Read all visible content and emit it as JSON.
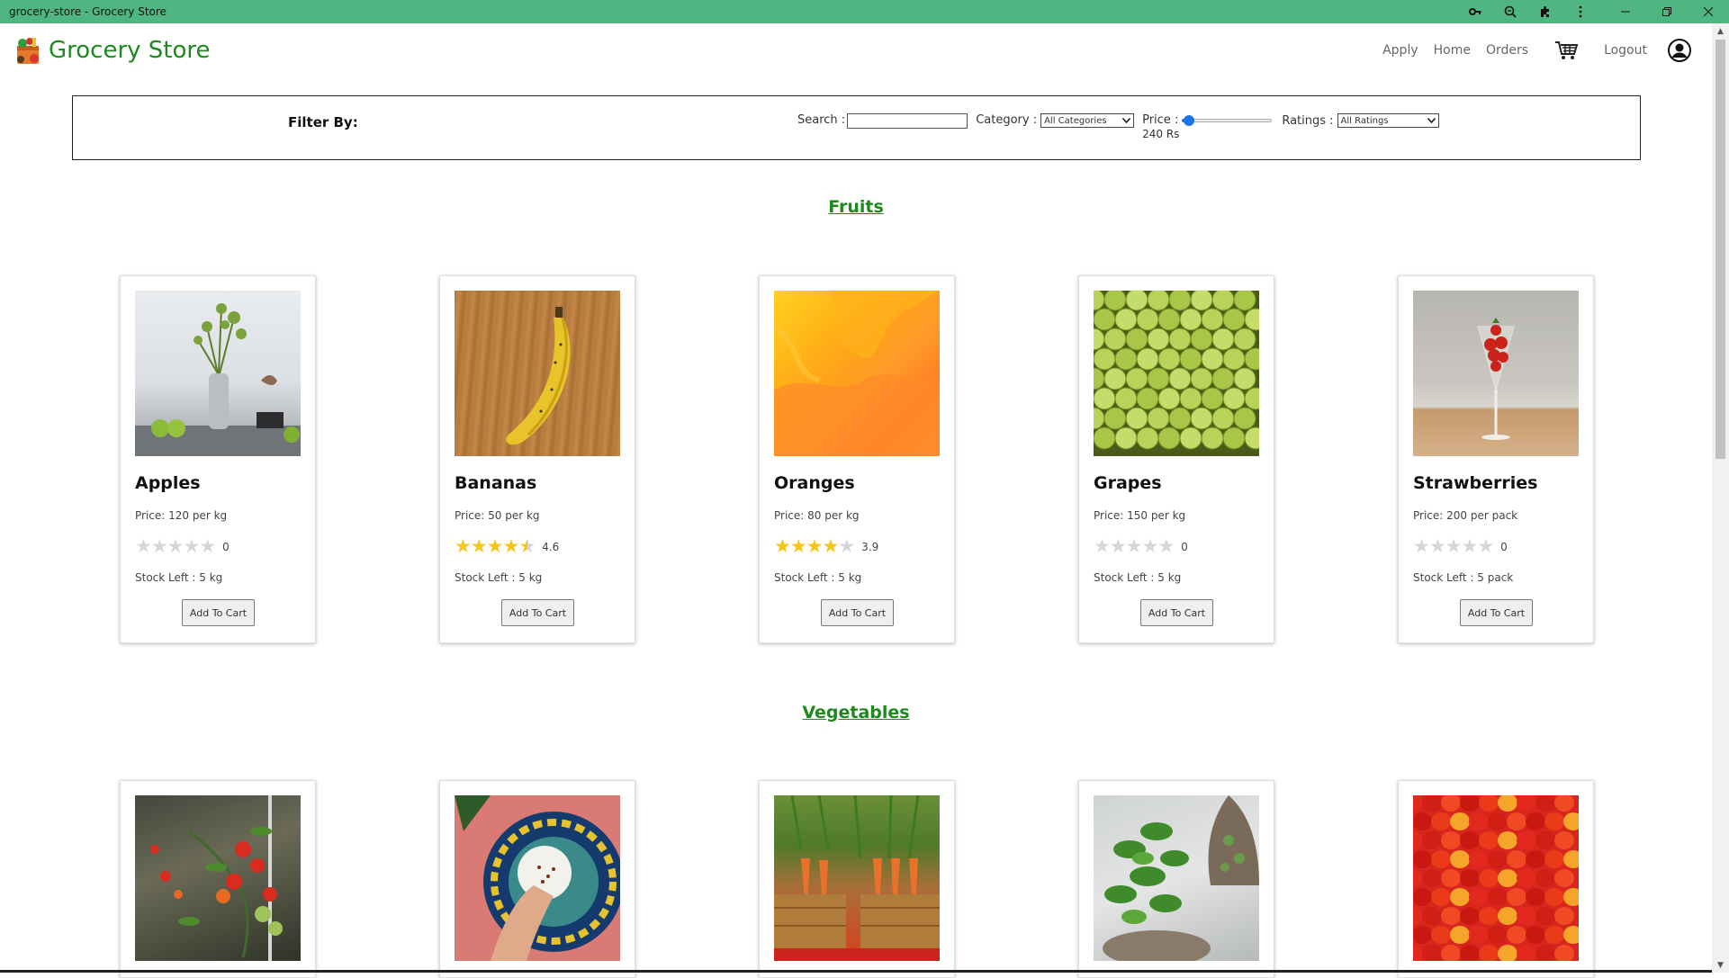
{
  "window": {
    "title": "grocery-store - Grocery Store",
    "accent_color": "#4fb682",
    "toolbar_icons": [
      "key-icon",
      "zoom-icon",
      "extensions-icon",
      "more-vert-icon"
    ],
    "controls": [
      "minimize",
      "restore",
      "close"
    ]
  },
  "header": {
    "brand": "Grocery Store",
    "brand_color": "#1c8a1c",
    "nav": {
      "apply": "Apply",
      "home": "Home",
      "orders": "Orders",
      "logout": "Logout"
    }
  },
  "filter": {
    "label": "Filter By:",
    "search_label": "Search :",
    "search_value": "",
    "category_label": "Category :",
    "category_selected": "All Categories",
    "price_label": "Price :",
    "price_value": "240 Rs",
    "price_fraction": 0.02,
    "ratings_label": "Ratings :",
    "ratings_selected": "All Ratings"
  },
  "sections": [
    {
      "title": "Fruits",
      "products": [
        {
          "name": "Apples",
          "price": "Price: 120 per kg",
          "rating": 0,
          "rating_text": "0",
          "stock": "Stock Left : 5 kg",
          "button": "Add To Cart",
          "image": "apples-photo"
        },
        {
          "name": "Bananas",
          "price": "Price: 50 per kg",
          "rating": 4.6,
          "rating_text": "4.6",
          "stock": "Stock Left : 5 kg",
          "button": "Add To Cart",
          "image": "banana-photo"
        },
        {
          "name": "Oranges",
          "price": "Price: 80 per kg",
          "rating": 3.9,
          "rating_text": "3.9",
          "stock": "Stock Left : 5 kg",
          "button": "Add To Cart",
          "image": "orange-abstract-photo"
        },
        {
          "name": "Grapes",
          "price": "Price: 150 per kg",
          "rating": 0,
          "rating_text": "0",
          "stock": "Stock Left : 5 kg",
          "button": "Add To Cart",
          "image": "grapes-photo"
        },
        {
          "name": "Strawberries",
          "price": "Price: 200 per pack",
          "rating": 0,
          "rating_text": "0",
          "stock": "Stock Left : 5 pack",
          "button": "Add To Cart",
          "image": "strawberries-photo"
        }
      ]
    },
    {
      "title": "Vegetables",
      "products": [
        {
          "image": "tomatoes-photo"
        },
        {
          "image": "plate-photo"
        },
        {
          "image": "carrots-photo"
        },
        {
          "image": "basil-photo"
        },
        {
          "image": "peppers-photo"
        }
      ]
    }
  ]
}
